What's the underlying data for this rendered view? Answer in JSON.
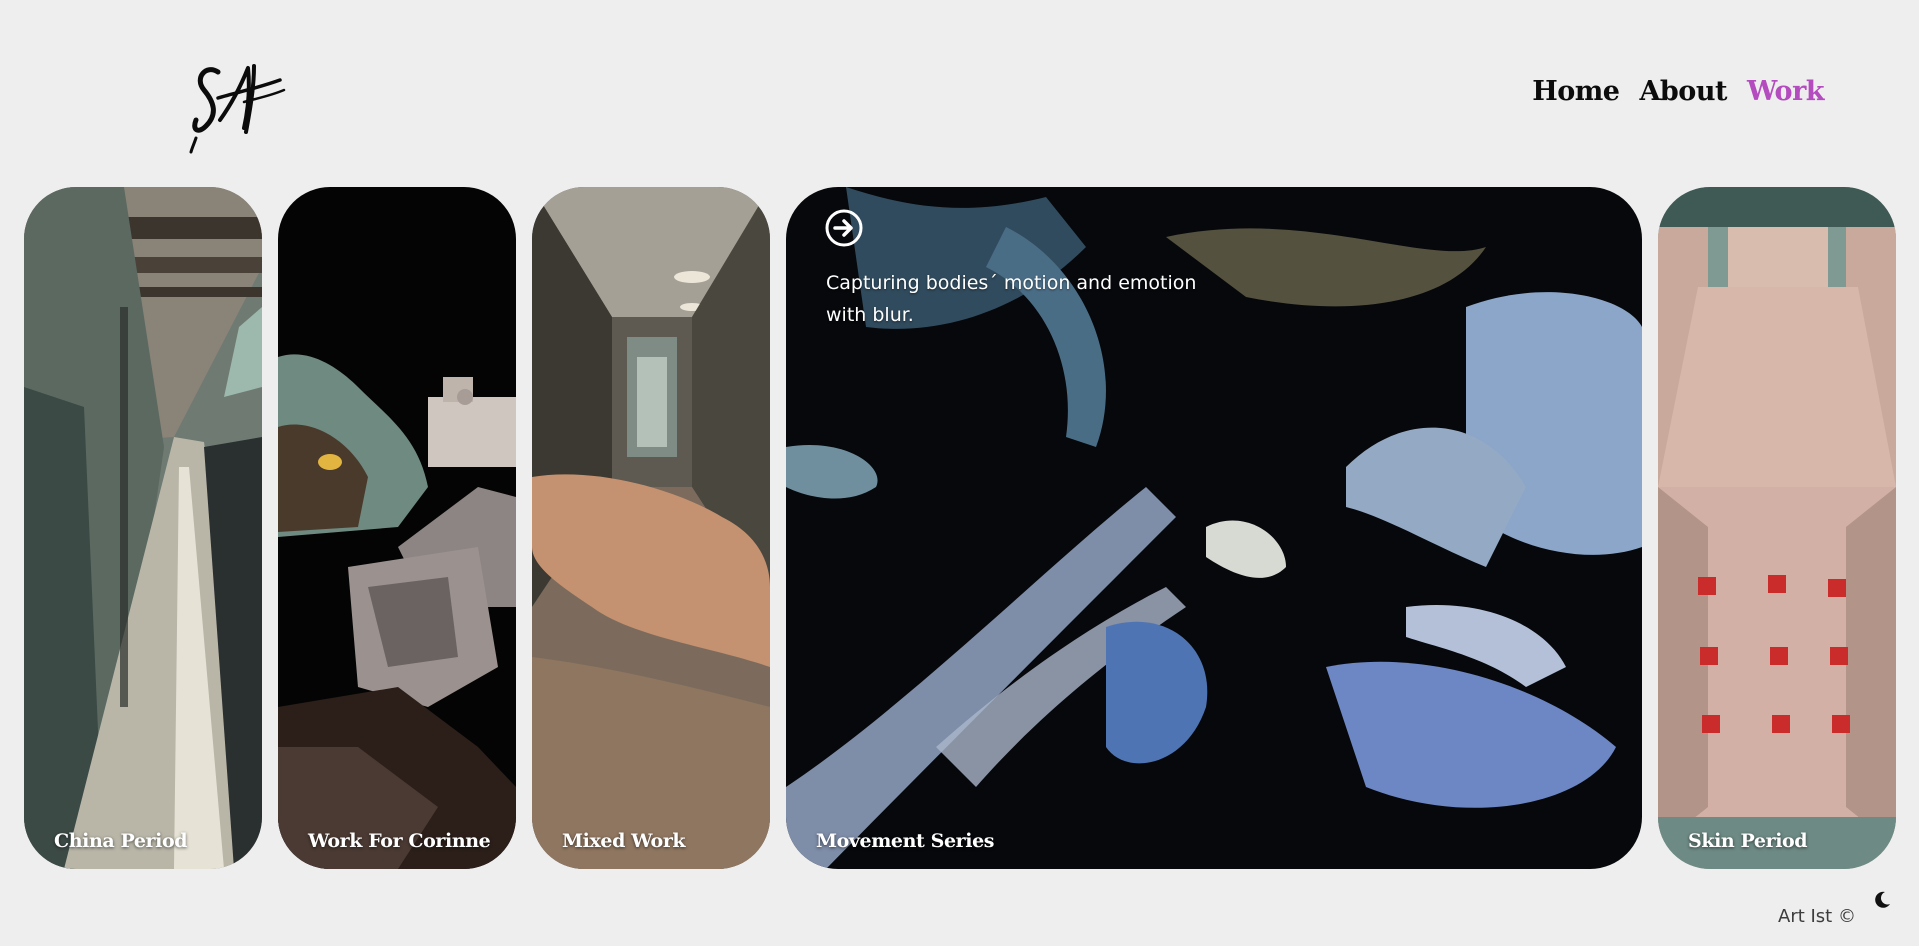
{
  "nav": {
    "items": [
      {
        "label": "Home",
        "active": false
      },
      {
        "label": "About",
        "active": false
      },
      {
        "label": "Work",
        "active": true
      }
    ],
    "active_color": "#b44bbf"
  },
  "cards": [
    {
      "label": "China Period"
    },
    {
      "label": "Work For Corinne"
    },
    {
      "label": "Mixed Work"
    },
    {
      "label": "Movement Series",
      "description": "Capturing bodies´ motion and emotion with blur."
    },
    {
      "label": "Skin Period"
    }
  ],
  "footer": {
    "text": "Art Ist ©"
  },
  "icons": {
    "logo": "signature-logo",
    "arrow": "arrow-circle-right-icon",
    "theme": "moon-icon"
  }
}
